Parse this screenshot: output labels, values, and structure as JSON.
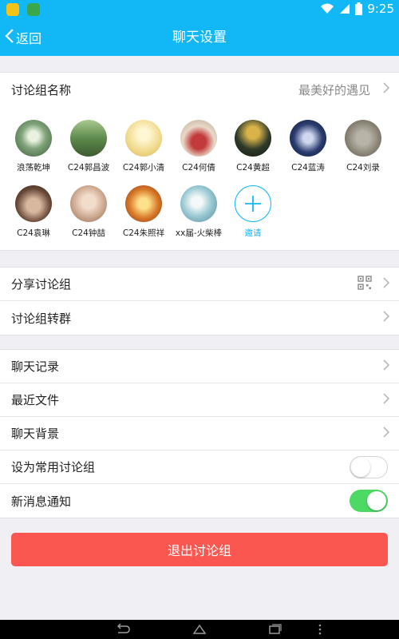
{
  "status_bar": {
    "time": "9:25"
  },
  "header": {
    "back_label": "返回",
    "title": "聊天设置"
  },
  "group_name": {
    "label": "讨论组名称",
    "value": "最美好的遇见"
  },
  "members": [
    {
      "name": "浪荡乾坤",
      "color": "#7fa37a"
    },
    {
      "name": "C24郭昌波",
      "color": "#5e8a4d"
    },
    {
      "name": "C24郭小清",
      "color": "#f0d98a"
    },
    {
      "name": "C24何倩",
      "color": "#9c2a2a"
    },
    {
      "name": "C24黄超",
      "color": "#2f3a2a"
    },
    {
      "name": "C24蓝涛",
      "color": "#2a3c6e"
    },
    {
      "name": "C24刘录",
      "color": "#8a8577"
    },
    {
      "name": "C24袁琳",
      "color": "#6b4b3a"
    },
    {
      "name": "C24钟喆",
      "color": "#c9a48c"
    },
    {
      "name": "C24朱照祥",
      "color": "#d87a2a"
    },
    {
      "name": "xx届-火柴棒",
      "color": "#6fa8b8"
    }
  ],
  "invite": {
    "label": "邀请"
  },
  "share_rows": [
    {
      "label": "分享讨论组"
    },
    {
      "label": "讨论组转群"
    }
  ],
  "settings_rows": [
    {
      "label": "聊天记录"
    },
    {
      "label": "最近文件"
    },
    {
      "label": "聊天背景"
    }
  ],
  "toggles": [
    {
      "label": "设为常用讨论组",
      "on": false
    },
    {
      "label": "新消息通知",
      "on": true
    }
  ],
  "exit_button": {
    "label": "退出讨论组"
  },
  "colors": {
    "accent": "#12b7f5",
    "danger": "#f9574f",
    "toggle_on": "#4cd964"
  }
}
